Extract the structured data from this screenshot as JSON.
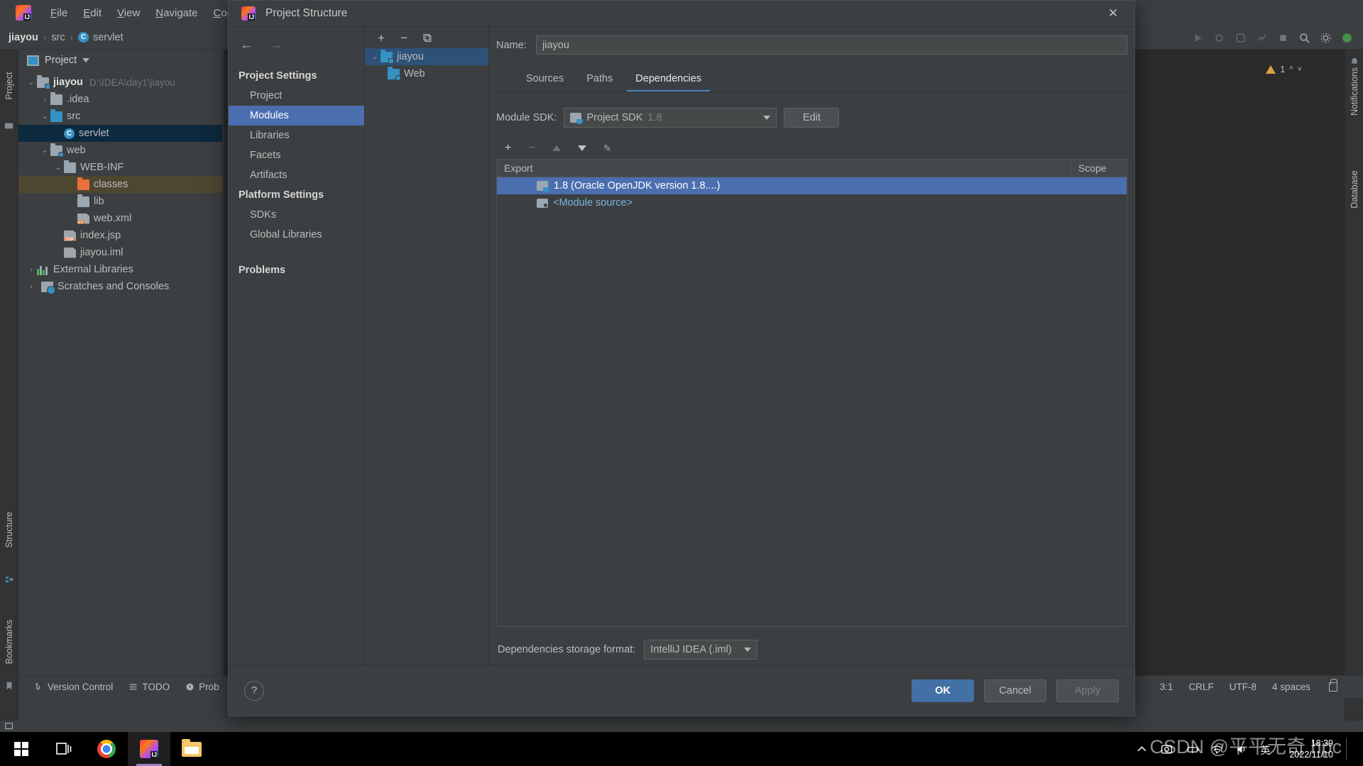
{
  "ide": {
    "menu": [
      "File",
      "Edit",
      "View",
      "Navigate",
      "Code"
    ],
    "breadcrumb": {
      "project": "jiayou",
      "folder": "src",
      "file": "servlet",
      "sep": "›"
    },
    "project_panel": {
      "title": "Project",
      "tree": [
        {
          "label": "jiayou",
          "path": "D:\\IDEA\\day1\\jiayou",
          "twisty": "⌄",
          "icon": "module-folder",
          "bold": true,
          "indent": 0
        },
        {
          "label": ".idea",
          "path": "",
          "twisty": "›",
          "icon": "folder",
          "bold": false,
          "indent": 1
        },
        {
          "label": "src",
          "path": "",
          "twisty": "⌄",
          "icon": "source-folder",
          "bold": false,
          "indent": 1
        },
        {
          "label": "servlet",
          "path": "",
          "twisty": "",
          "icon": "class",
          "bold": false,
          "indent": 2,
          "state": "selected"
        },
        {
          "label": "web",
          "path": "",
          "twisty": "⌄",
          "icon": "web-folder",
          "bold": false,
          "indent": 1
        },
        {
          "label": "WEB-INF",
          "path": "",
          "twisty": "⌄",
          "icon": "folder",
          "bold": false,
          "indent": 2
        },
        {
          "label": "classes",
          "path": "",
          "twisty": "",
          "icon": "excluded-folder",
          "bold": false,
          "indent": 3,
          "state": "highlighted"
        },
        {
          "label": "lib",
          "path": "",
          "twisty": "",
          "icon": "folder",
          "bold": false,
          "indent": 3
        },
        {
          "label": "web.xml",
          "path": "",
          "twisty": "",
          "icon": "xml-file",
          "bold": false,
          "indent": 3
        },
        {
          "label": "index.jsp",
          "path": "",
          "twisty": "",
          "icon": "jsp-file",
          "bold": false,
          "indent": 2
        },
        {
          "label": "jiayou.iml",
          "path": "",
          "twisty": "",
          "icon": "iml-file",
          "bold": false,
          "indent": 2
        },
        {
          "label": "External Libraries",
          "path": "",
          "twisty": "›",
          "icon": "libraries",
          "bold": false,
          "indent": 0
        },
        {
          "label": "Scratches and Consoles",
          "path": "",
          "twisty": "›",
          "icon": "scratches",
          "bold": false,
          "indent": 0
        }
      ]
    },
    "left_strip": [
      "Project",
      "Structure",
      "Bookmarks"
    ],
    "right_strip": [
      "Notifications",
      "Database"
    ],
    "editor": {
      "warning_count": "1"
    },
    "statusbar": {
      "version_control": "Version Control",
      "todo": "TODO",
      "problems": "Prob",
      "caret": "3:1",
      "line_sep": "CRLF",
      "encoding": "UTF-8",
      "indent": "4 spaces"
    }
  },
  "dialog": {
    "title": "Project Structure",
    "close_label": "✕",
    "nav": {
      "back": "←",
      "forward": "→"
    },
    "sidebar": {
      "project_settings_header": "Project Settings",
      "project_settings": [
        "Project",
        "Modules",
        "Libraries",
        "Facets",
        "Artifacts"
      ],
      "platform_settings_header": "Platform Settings",
      "platform_settings": [
        "SDKs",
        "Global Libraries"
      ],
      "problems": "Problems",
      "active": "Modules"
    },
    "modules_tree": {
      "toolbar": {
        "add": "+",
        "remove": "−",
        "copy": "⧉"
      },
      "items": [
        {
          "label": "jiayou",
          "twisty": "⌄",
          "icon": "module-folder",
          "selected": true,
          "indent": 0
        },
        {
          "label": "Web",
          "twisty": "",
          "icon": "web-facet",
          "selected": false,
          "indent": 1
        }
      ]
    },
    "name": {
      "label": "Name:",
      "value": "jiayou"
    },
    "tabs": [
      {
        "label": "Sources",
        "active": false
      },
      {
        "label": "Paths",
        "active": false
      },
      {
        "label": "Dependencies",
        "active": true
      }
    ],
    "module_sdk": {
      "label": "Module SDK:",
      "value": "Project SDK",
      "value_suffix": "1.8",
      "edit_button": "Edit"
    },
    "deps_toolbar": {
      "add": "+",
      "remove": "−",
      "up": "up-arrow",
      "down": "down-arrow",
      "edit": "✎"
    },
    "deps_table": {
      "columns": [
        "Export",
        "Scope"
      ],
      "rows": [
        {
          "name": "1.8 (Oracle OpenJDK version 1.8....)",
          "scope": "",
          "icon": "sdk-icon",
          "selected": true,
          "link": false
        },
        {
          "name": "<Module source>",
          "scope": "",
          "icon": "module-source-icon",
          "selected": false,
          "link": true
        }
      ]
    },
    "storage_format": {
      "label": "Dependencies storage format:",
      "value": "IntelliJ IDEA (.iml)"
    },
    "footer": {
      "help": "?",
      "ok": "OK",
      "cancel": "Cancel",
      "apply": "Apply"
    }
  },
  "taskbar": {
    "items": [
      "start-button",
      "task-view",
      "chrome",
      "intellij-idea",
      "file-explorer"
    ],
    "clock": {
      "time": "18:39",
      "date": "2022/11/10"
    },
    "tray": [
      "chevron-up",
      "screenshot-tool",
      "battery",
      "wifi",
      "volume",
      "ime-chinese"
    ]
  },
  "watermark": "CSDN @平平无奇 hpc",
  "colors": {
    "accent": "#4b6eaf",
    "panel": "#3c3f41",
    "editor": "#2b2b2b",
    "selection": "#2d5177",
    "link": "#7ab4e0"
  }
}
